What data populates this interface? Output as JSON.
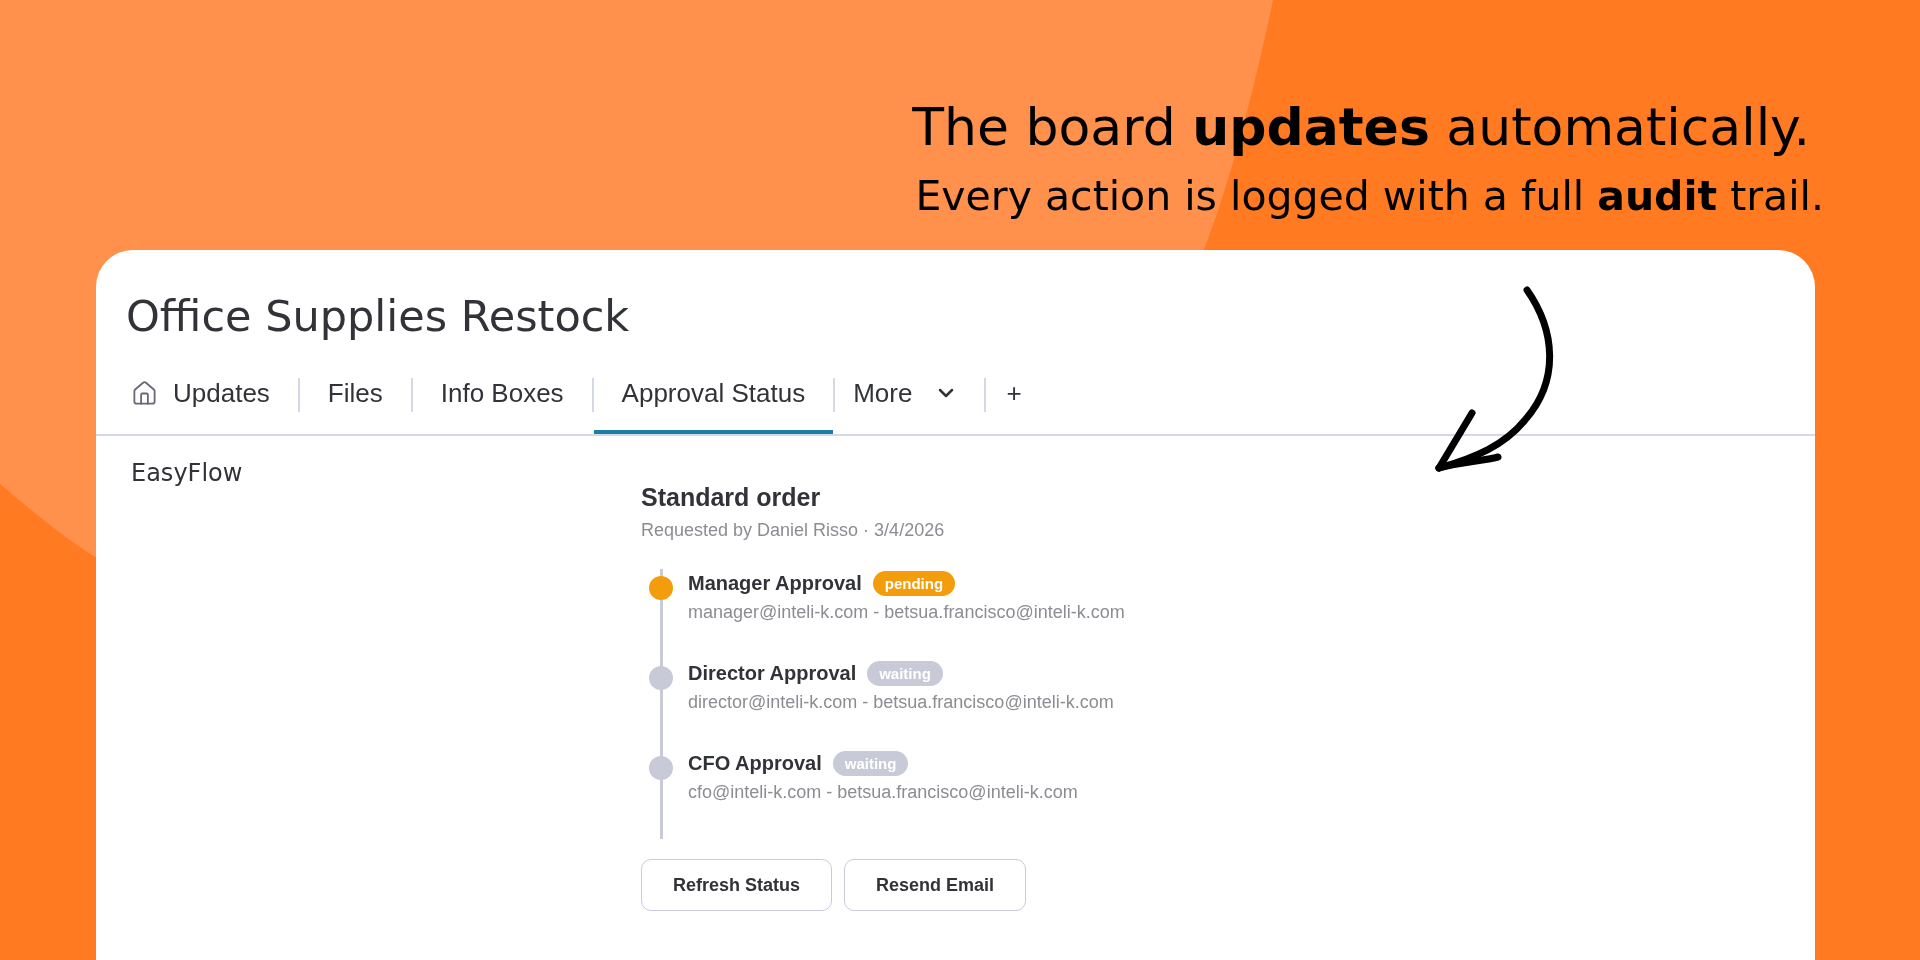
{
  "headline": {
    "title": "The board **updates** automatically.",
    "subtitle": "Every action is logged with a full **audit** trail."
  },
  "board": {
    "title": "Office Supplies Restock",
    "tabs": [
      {
        "kind": "home",
        "label": "Updates",
        "selected": false
      },
      {
        "kind": "text",
        "label": "Files",
        "selected": false
      },
      {
        "kind": "text",
        "label": "Info Boxes",
        "selected": false
      },
      {
        "kind": "text",
        "label": "Approval Status",
        "selected": true
      },
      {
        "kind": "menu",
        "label": "More",
        "selected": false
      },
      {
        "kind": "add",
        "label": "+",
        "selected": false
      }
    ]
  },
  "sidebar": {
    "title": "EasyFlow"
  },
  "approval": {
    "title": "Standard order",
    "meta": "Requested by Daniel Risso · 3/4/2026",
    "steps": [
      {
        "name": "Manager Approval",
        "status": "pending",
        "color": "#f49d0c",
        "approvers": "manager@inteli-k.com - betsua.francisco@inteli-k.com"
      },
      {
        "name": "Director Approval",
        "status": "waiting",
        "color": "#c8cad8",
        "approvers": "director@inteli-k.com - betsua.francisco@inteli-k.com"
      },
      {
        "name": "CFO Approval",
        "status": "waiting",
        "color": "#c8cad8",
        "approvers": "cfo@inteli-k.com - betsua.francisco@inteli-k.com"
      }
    ],
    "buttons": [
      "Refresh Status",
      "Resend Email"
    ]
  }
}
